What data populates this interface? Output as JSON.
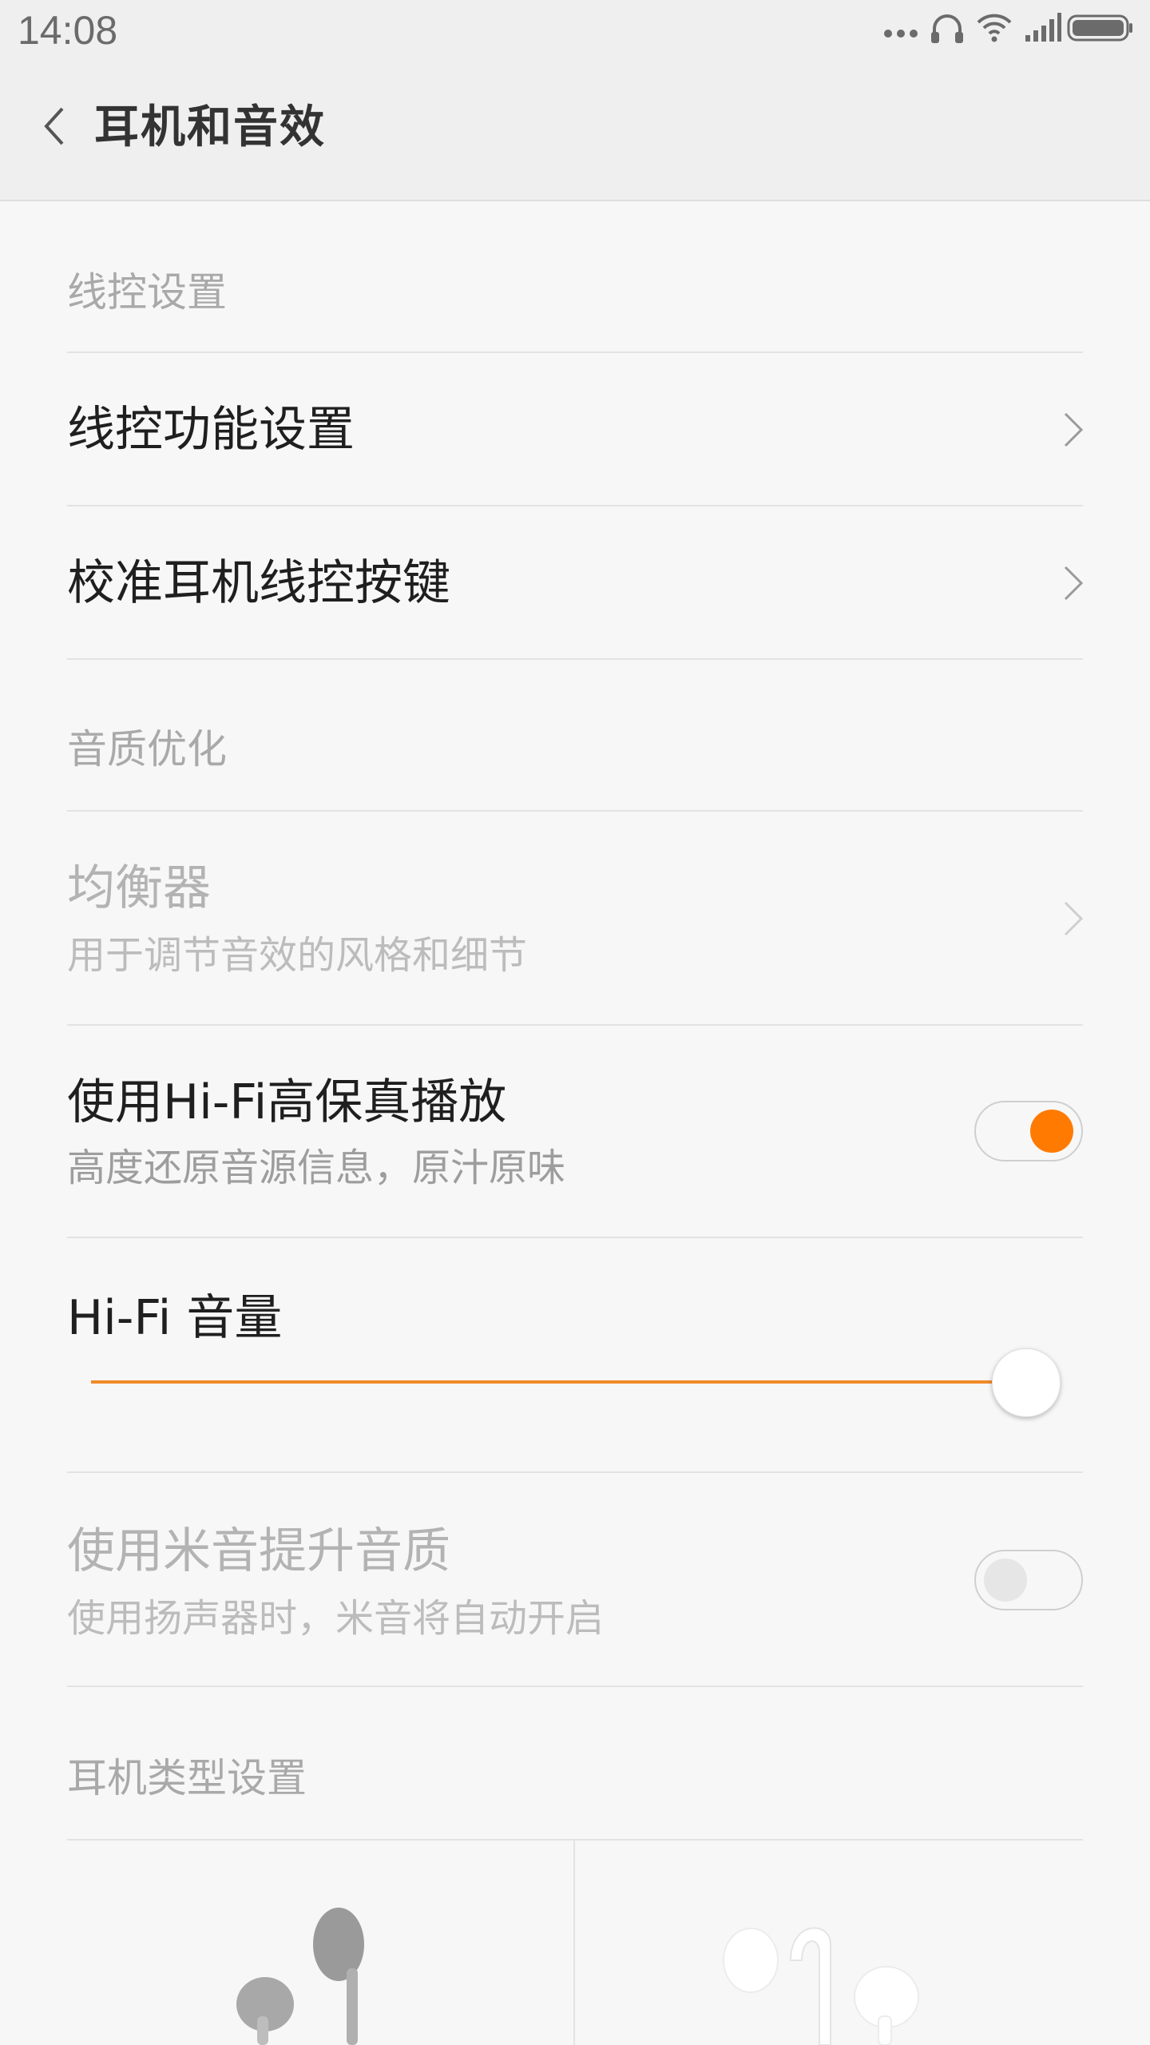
{
  "status_bar": {
    "time": "14:08",
    "icons": [
      "more-dots-icon",
      "headset-icon",
      "wifi-icon",
      "signal-icon",
      "battery-icon"
    ]
  },
  "app_bar": {
    "back_icon": "chevron-left-icon",
    "title": "耳机和音效"
  },
  "sections": {
    "wire_control": {
      "header": "线控设置",
      "items": [
        {
          "title": "线控功能设置"
        },
        {
          "title": "校准耳机线控按键"
        }
      ]
    },
    "sound_quality": {
      "header": "音质优化",
      "equalizer": {
        "title": "均衡器",
        "summary": "用于调节音效的风格和细节",
        "enabled": false
      },
      "hifi": {
        "title": "使用Hi-Fi高保真播放",
        "summary": "高度还原音源信息，原汁原味",
        "checked": true
      },
      "hifi_volume": {
        "title": "Hi-Fi 音量",
        "level_percent": 100
      },
      "mi_sound": {
        "title": "使用米音提升音质",
        "summary": "使用扬声器时，米音将自动开启",
        "checked": false,
        "enabled": false
      }
    },
    "earphone_type": {
      "header": "耳机类型设置",
      "options": [
        {
          "icon": "earbud-headphones-gray-icon"
        },
        {
          "icon": "in-ear-headphones-white-icon"
        }
      ]
    }
  },
  "colors": {
    "accent": "#ff7a00",
    "background": "#f7f7f7",
    "header_bg": "#efefef"
  }
}
